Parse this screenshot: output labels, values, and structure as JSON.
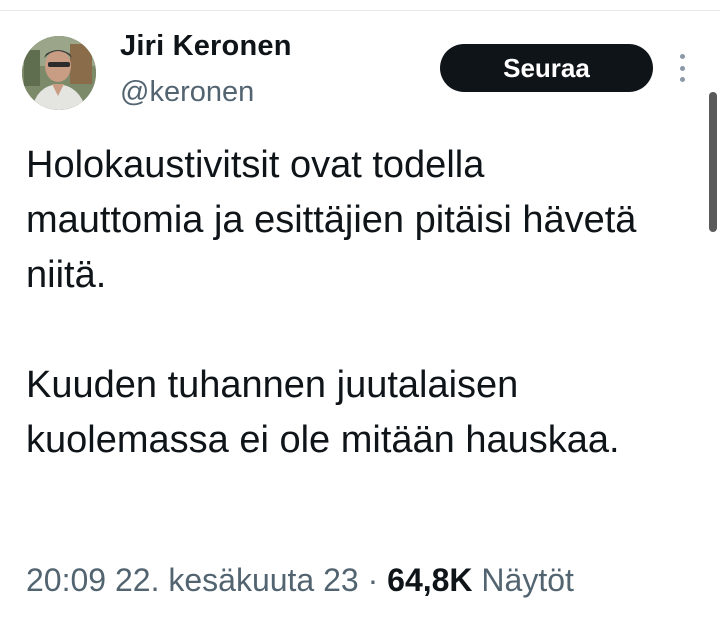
{
  "author": {
    "display_name": "Jiri Keronen",
    "handle": "@keronen"
  },
  "follow_button": {
    "label": "Seuraa"
  },
  "more_menu": {
    "icon": "more-vertical-icon"
  },
  "tweet": {
    "paragraphs": [
      "Holokaustivitsit ovat todella mauttomia ja esittäjien pitäisi hävetä niitä.",
      "Kuuden tuhannen juutalaisen kuolemassa ei ole mitään hauskaa."
    ]
  },
  "meta": {
    "timestamp": "20:09 22. kesäkuuta 23",
    "separator": "·",
    "views_count": "64,8K",
    "views_label": "Näytöt"
  },
  "colors": {
    "text_primary": "#0f1419",
    "text_secondary": "#536471",
    "button_bg": "#0f1419",
    "button_text": "#ffffff",
    "divider": "#e7e9ea"
  }
}
